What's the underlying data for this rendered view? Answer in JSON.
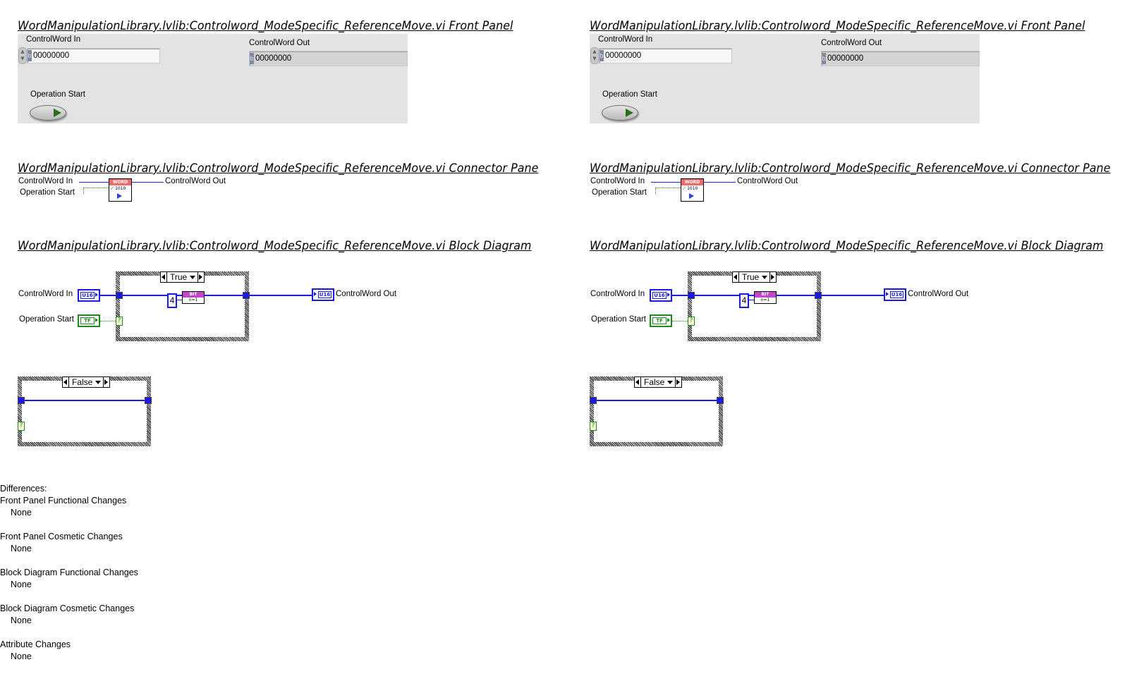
{
  "columns": [
    {
      "id": "left",
      "front_panel": {
        "title": "WordManipulationLibrary.lvlib:Controlword_ModeSpecific_ReferenceMove.vi Front Panel",
        "controlword_in": {
          "label": "ControlWord In",
          "radix": "b",
          "value": "00000000"
        },
        "controlword_out": {
          "label": "ControlWord Out",
          "radix": "b",
          "value": "00000000"
        },
        "operation_start": {
          "label": "Operation Start",
          "state": false
        }
      },
      "connector_pane": {
        "title": "WordManipulationLibrary.lvlib:Controlword_ModeSpecific_ReferenceMove.vi Connector Pane",
        "inputs": [
          "ControlWord In",
          "Operation Start"
        ],
        "outputs": [
          "ControlWord Out"
        ],
        "icon_header": "WORD",
        "icon_body": "1010"
      },
      "block_diagram": {
        "title": "WordManipulationLibrary.lvlib:Controlword_ModeSpecific_ReferenceMove.vi Block Diagram",
        "controlword_in_label": "ControlWord In",
        "controlword_in_type": "U16",
        "operation_start_label": "Operation Start",
        "operation_start_type": "TF",
        "controlword_out_label": "ControlWord Out",
        "controlword_out_type": "U16",
        "case_true_label": "True",
        "case_false_label": "False",
        "constant_value": "4",
        "bit_function_top": "BIT",
        "bit_function_bottom": "n=1",
        "selector_glyph": "?"
      }
    },
    {
      "id": "right",
      "front_panel": {
        "title": "WordManipulationLibrary.lvlib:Controlword_ModeSpecific_ReferenceMove.vi Front Panel",
        "controlword_in": {
          "label": "ControlWord In",
          "radix": "b",
          "value": "00000000"
        },
        "controlword_out": {
          "label": "ControlWord Out",
          "radix": "b",
          "value": "00000000"
        },
        "operation_start": {
          "label": "Operation Start",
          "state": false
        }
      },
      "connector_pane": {
        "title": "WordManipulationLibrary.lvlib:Controlword_ModeSpecific_ReferenceMove.vi Connector Pane",
        "inputs": [
          "ControlWord In",
          "Operation Start"
        ],
        "outputs": [
          "ControlWord Out"
        ],
        "icon_header": "WORD",
        "icon_body": "1010"
      },
      "block_diagram": {
        "title": "WordManipulationLibrary.lvlib:Controlword_ModeSpecific_ReferenceMove.vi Block Diagram",
        "controlword_in_label": "ControlWord In",
        "controlword_in_type": "U16",
        "operation_start_label": "Operation Start",
        "operation_start_type": "TF",
        "controlword_out_label": "ControlWord Out",
        "controlword_out_type": "U16",
        "case_true_label": "True",
        "case_false_label": "False",
        "constant_value": "4",
        "bit_function_top": "BIT",
        "bit_function_bottom": "n=1",
        "selector_glyph": "?"
      }
    }
  ],
  "differences": {
    "heading": "Differences:",
    "sections": [
      {
        "title": "Front Panel Functional Changes",
        "value": "None"
      },
      {
        "title": "Front Panel Cosmetic Changes",
        "value": "None"
      },
      {
        "title": "Block Diagram Functional Changes",
        "value": "None"
      },
      {
        "title": "Block Diagram Cosmetic Changes",
        "value": "None"
      },
      {
        "title": "Attribute Changes",
        "value": "None"
      }
    ]
  },
  "colors": {
    "wire_u16": "#1a1ae6",
    "wire_boolean": "#1e8a1e",
    "panel_bg": "#e3e3e3",
    "icon_header": "#f06a6a",
    "bit_function": "#c246c6"
  }
}
